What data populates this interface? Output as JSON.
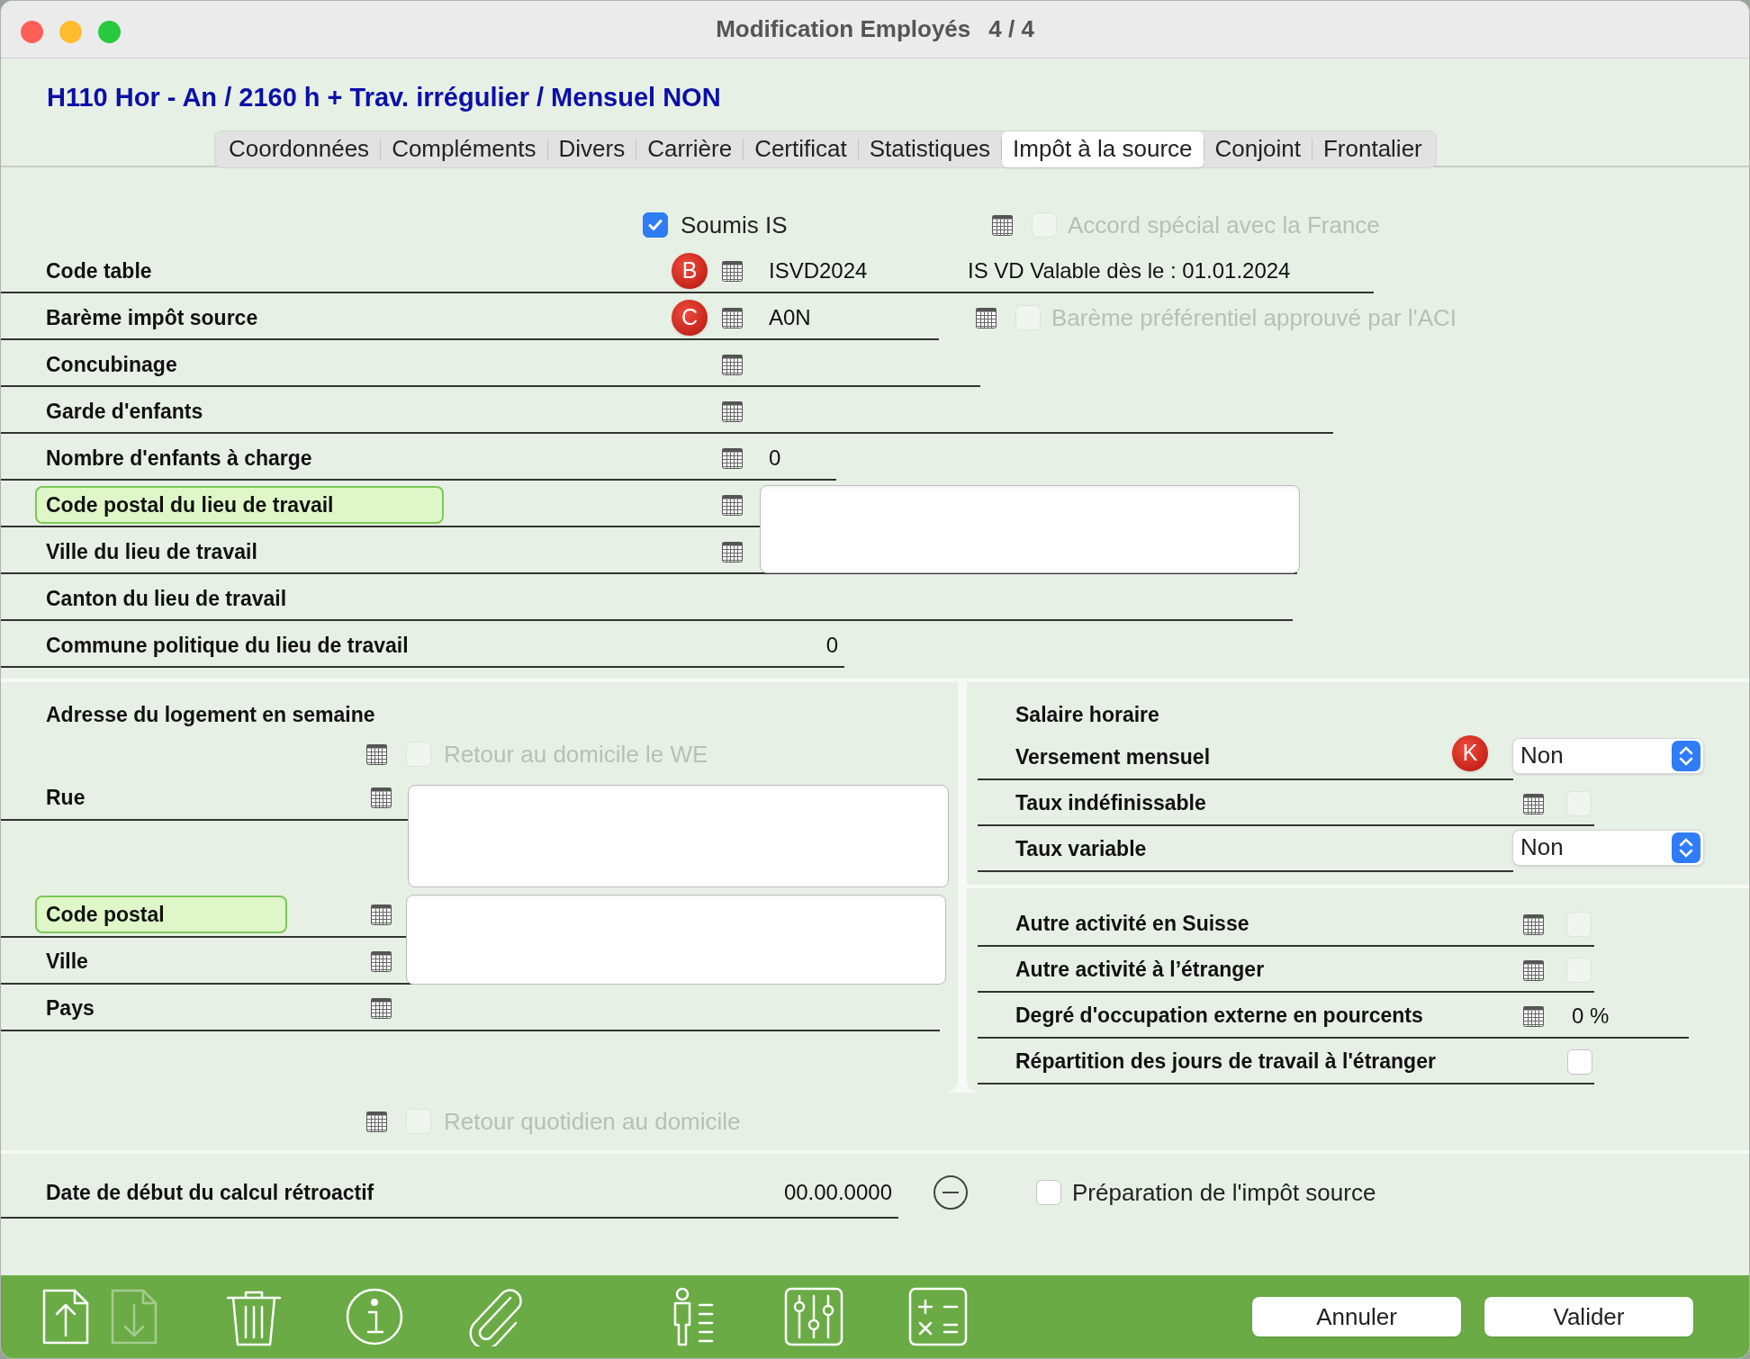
{
  "window": {
    "title": "Modification Employés",
    "counter": "4 / 4"
  },
  "header": "H110 Hor - An / 2160 h + Trav. irrégulier / Mensuel NON",
  "tabs": [
    {
      "label": "Coordonnées",
      "selected": false
    },
    {
      "label": "Compléments",
      "selected": false
    },
    {
      "label": "Divers",
      "selected": false
    },
    {
      "label": "Carrière",
      "selected": false
    },
    {
      "label": "Certificat",
      "selected": false
    },
    {
      "label": "Statistiques",
      "selected": false
    },
    {
      "label": "Impôt à la source",
      "selected": true
    },
    {
      "label": "Conjoint",
      "selected": false
    },
    {
      "label": "Frontalier",
      "selected": false
    }
  ],
  "soumis": {
    "label": "Soumis IS",
    "checked": true,
    "disabled": false
  },
  "accord": {
    "label": "Accord spécial avec la France",
    "checked": false,
    "disabled": true
  },
  "fields": [
    {
      "label": "Code table",
      "badge": "B",
      "value": "ISVD2024",
      "note": "IS VD Valable dès le : 01.01.2024",
      "highlighted": false
    },
    {
      "label": "Barème impôt source",
      "badge": "C",
      "value": "A0N",
      "option": {
        "label": "Barème préférentiel approuvé par l'ACI",
        "checked": false,
        "disabled": true
      },
      "highlighted": false
    },
    {
      "label": "Concubinage",
      "highlighted": false
    },
    {
      "label": "Garde d'enfants",
      "highlighted": false
    },
    {
      "label": "Nombre d'enfants à charge",
      "value": "0",
      "highlighted": false
    },
    {
      "label": "Code postal du lieu de travail",
      "highlighted": true
    },
    {
      "label": "Ville du lieu de travail",
      "highlighted": false
    },
    {
      "label": "Canton du lieu de travail",
      "highlighted": false
    },
    {
      "label": "Commune politique du lieu de travail",
      "value": "0",
      "highlighted": false
    }
  ],
  "address": {
    "title": "Adresse du logement en semaine",
    "retour_we": {
      "label": "Retour au domicile le WE",
      "checked": false,
      "disabled": true
    },
    "fields": [
      {
        "label": "Rue",
        "highlighted": false
      },
      {
        "label": "Code postal",
        "highlighted": true
      },
      {
        "label": "Ville",
        "highlighted": false
      },
      {
        "label": "Pays",
        "highlighted": false
      }
    ]
  },
  "salary": {
    "title": "Salaire horaire",
    "rows": [
      {
        "kind": "select",
        "label": "Versement mensuel",
        "badge": "K",
        "value": "Non"
      },
      {
        "kind": "checkbox",
        "label": "Taux indéfinissable",
        "checked": false,
        "disabled": true
      },
      {
        "kind": "select",
        "label": "Taux variable",
        "value": "Non"
      },
      {
        "kind": "separator"
      },
      {
        "kind": "checkbox",
        "label": "Autre activité en Suisse",
        "checked": false,
        "disabled": true
      },
      {
        "kind": "checkbox",
        "label": "Autre activité à l’étranger",
        "checked": false,
        "disabled": true
      },
      {
        "kind": "value",
        "label": "Degré d'occupation externe en pourcents",
        "value": "0 %"
      },
      {
        "kind": "plaincheckbox",
        "label": "Répartition des jours de travail à l'étranger",
        "checked": false,
        "disabled": false
      }
    ]
  },
  "retour_quotidien": {
    "label": "Retour quotidien au domicile",
    "checked": false,
    "disabled": true
  },
  "date_row": {
    "label": "Date de début du calcul rétroactif",
    "value": "00.00.0000"
  },
  "preparation": {
    "label": "Préparation de l'impôt source",
    "checked": false,
    "disabled": false
  },
  "toolbar": [
    {
      "kind": "upload",
      "disabled": false
    },
    {
      "kind": "download",
      "disabled": true
    },
    {
      "kind": "trash",
      "disabled": false
    },
    {
      "kind": "info",
      "disabled": false
    },
    {
      "kind": "attach",
      "disabled": false
    },
    {
      "kind": "person-list",
      "disabled": false
    },
    {
      "kind": "sliders",
      "disabled": false
    },
    {
      "kind": "calculator",
      "disabled": false
    }
  ],
  "buttons": [
    "Annuler",
    "Valider"
  ]
}
